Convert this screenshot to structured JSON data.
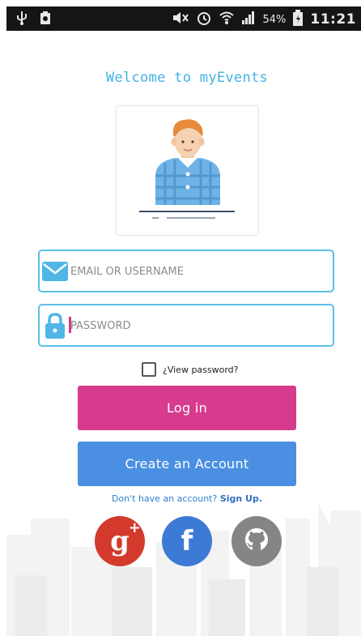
{
  "status_bar": {
    "battery_percent": "54%",
    "time": "11:21",
    "icons": [
      "usb-icon",
      "recycle-icon",
      "mute-icon",
      "alarm-icon",
      "wifi-icon",
      "signal-icon",
      "battery-icon"
    ]
  },
  "welcome": {
    "title": "Welcome to myEvents"
  },
  "login_form": {
    "email_placeholder": "EMAIL OR USERNAME",
    "password_placeholder": "PASSWORD",
    "view_password_label": "¿View password?",
    "login_label": "Log in",
    "create_account_label": "Create an Account"
  },
  "signup": {
    "prompt": "Don't have an account?",
    "link_label": "Sign Up."
  },
  "social": {
    "google_label": "g",
    "google_plus": "+",
    "facebook_label": "f",
    "icons": [
      "google-plus-icon",
      "facebook-icon",
      "github-icon"
    ]
  },
  "colors": {
    "accent_blue": "#5bc0e8",
    "login_pink": "#d63b8e",
    "create_blue": "#4a8fe2",
    "google_red": "#d33a2c",
    "facebook_blue": "#3d7ad6",
    "github_gray": "#858585"
  }
}
